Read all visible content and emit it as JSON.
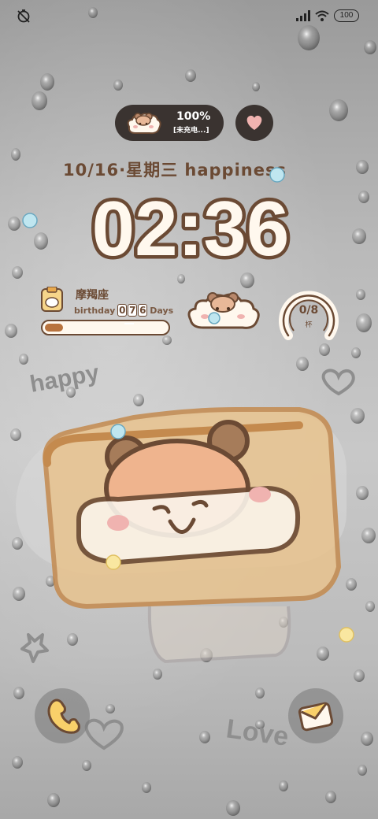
{
  "status_bar": {
    "left_icon": "do-not-disturb-icon",
    "right_icons": [
      "signal-icon",
      "wifi-icon"
    ],
    "battery": "100"
  },
  "charge_pill": {
    "percent": "100%",
    "status": "[未充电...]",
    "icon": "bear-icon"
  },
  "heart_button": {
    "icon": "heart-icon"
  },
  "date": {
    "text": "10/16·星期三 happiness"
  },
  "clock": {
    "time": "02:36"
  },
  "birthday_widget": {
    "title": "摩羯座",
    "label": "birthday",
    "digits": [
      "0",
      "7",
      "6"
    ],
    "unit": "Days",
    "progress": 0.15
  },
  "water_widget": {
    "count": "0/8",
    "unit": "杯",
    "progress": 0
  },
  "decor": {
    "happy_text": "happy",
    "love_text": "Love"
  },
  "shortcuts": {
    "left_icon": "phone-icon",
    "right_icon": "message-icon"
  },
  "colors": {
    "brown": "#6b4a34",
    "dark_pill": "#3a3330",
    "cream": "#fff8ee",
    "pink": "#f0b3b0",
    "toast": "#d9a066"
  }
}
